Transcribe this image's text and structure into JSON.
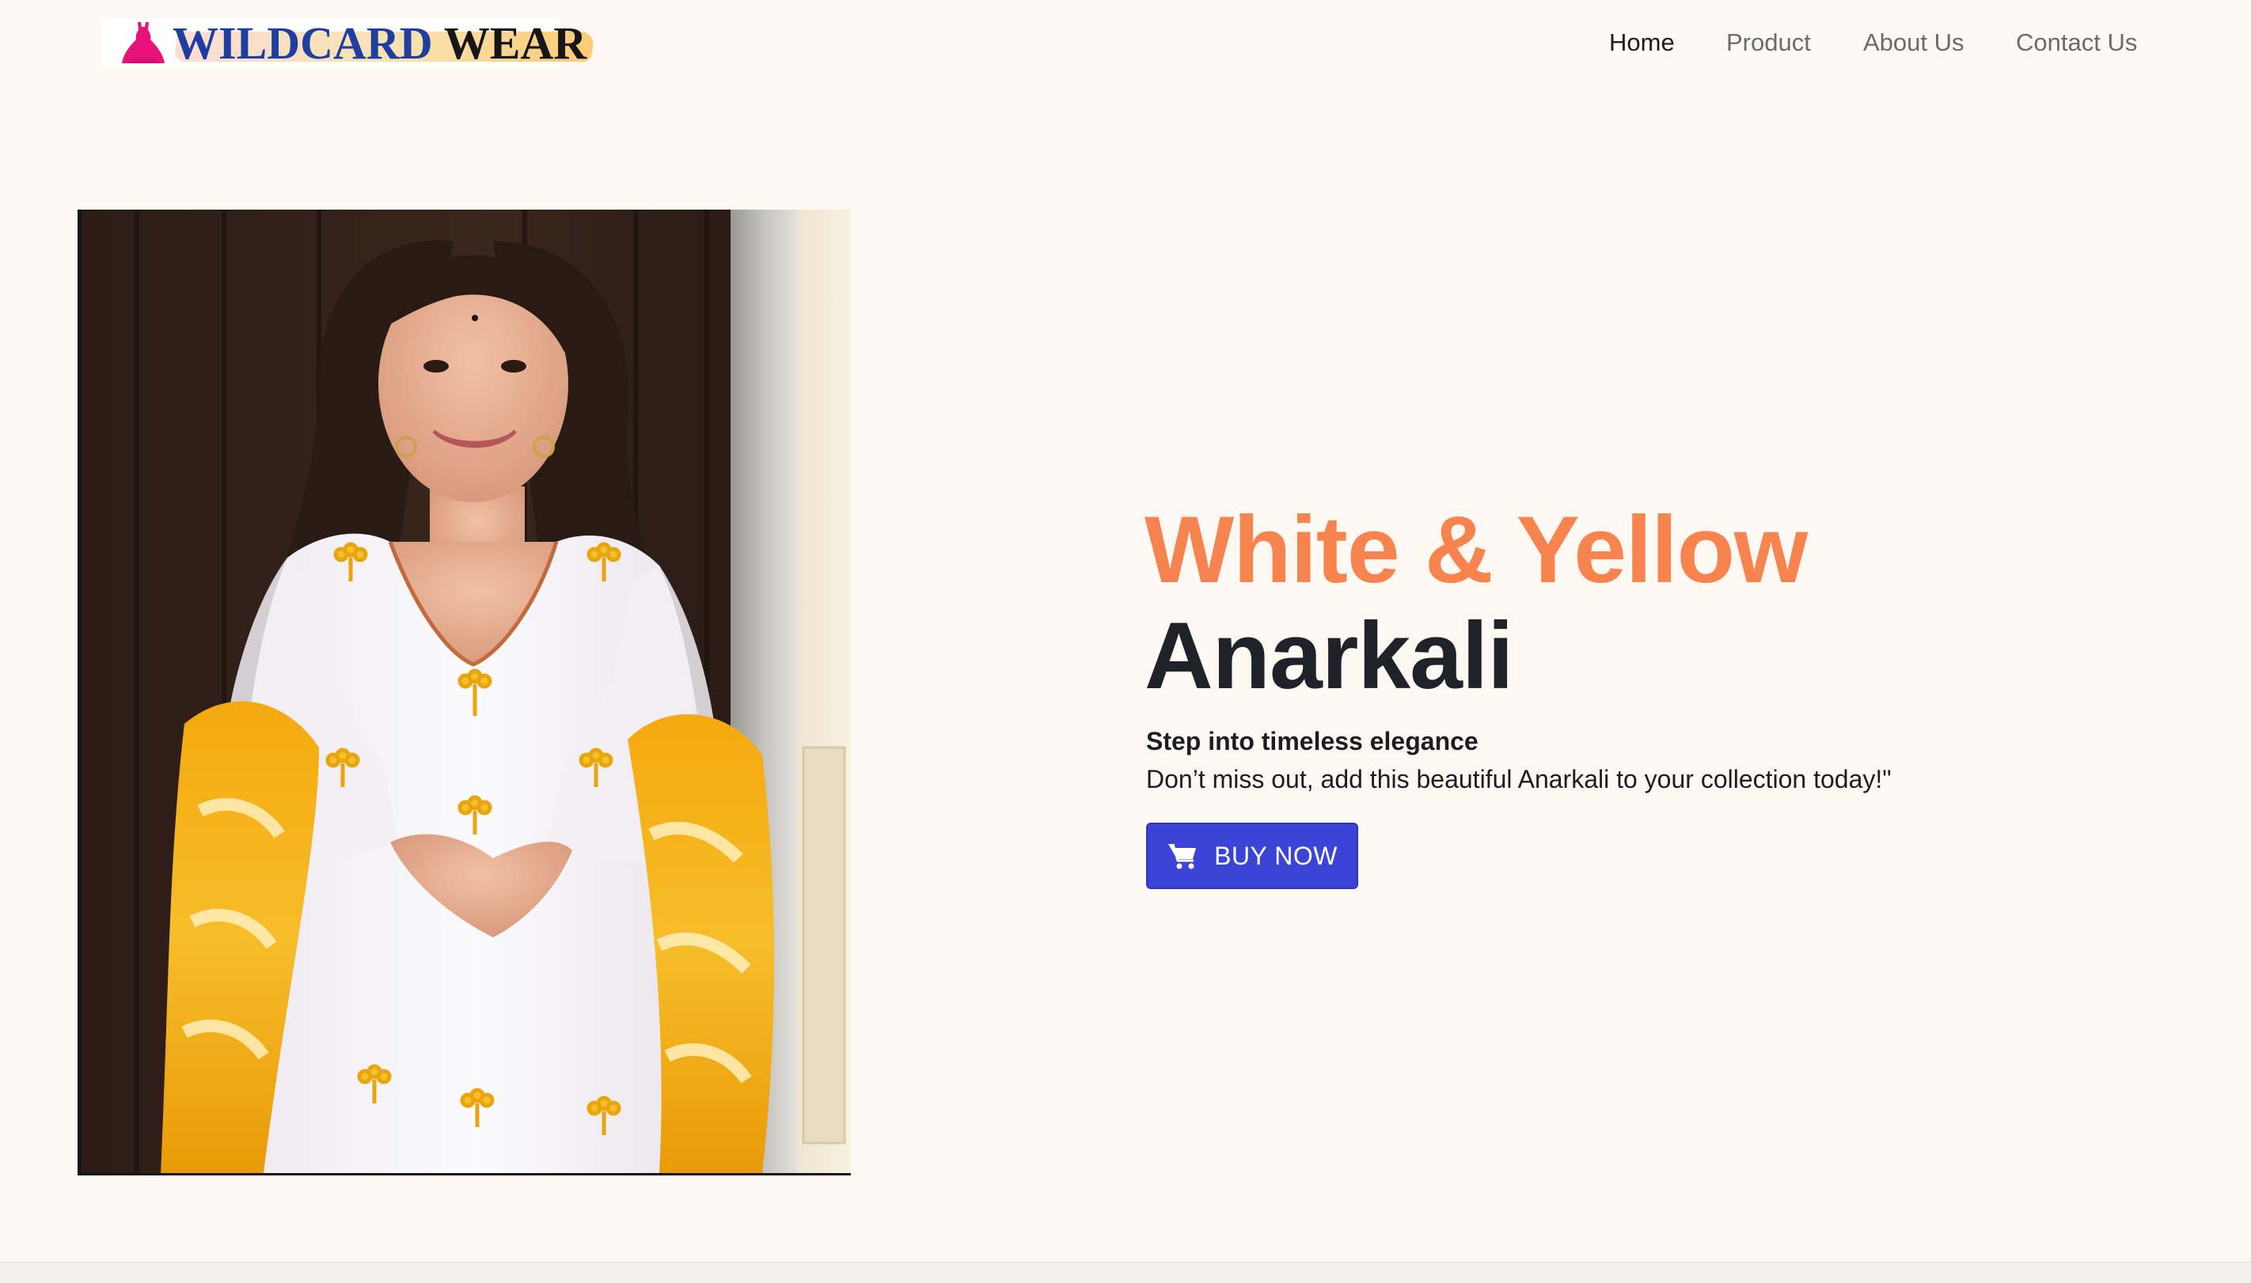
{
  "header": {
    "logo": {
      "word1": "WILDCARD",
      "word2": "WEAR",
      "icon": "dress-icon",
      "icon_color": "#e8127a"
    },
    "nav": [
      {
        "label": "Home",
        "active": true
      },
      {
        "label": "Product",
        "active": false
      },
      {
        "label": "About Us",
        "active": false
      },
      {
        "label": "Contact Us",
        "active": false
      }
    ]
  },
  "hero": {
    "title_line1": "White & Yellow",
    "title_line2": "Anarkali",
    "subtitle": "Step into timeless elegance",
    "body": "Don’t miss out, add this beautiful Anarkali to your collection today!\"",
    "button": {
      "label": "BUY NOW",
      "icon": "cart-icon"
    },
    "image": "model-in-white-and-yellow-anarkali"
  },
  "colors": {
    "background": "#fef8f2",
    "accent_orange": "#f7834e",
    "title_dark": "#1f2228",
    "button_blue": "#3b44d4",
    "logo_blue": "#1e3fa0"
  }
}
